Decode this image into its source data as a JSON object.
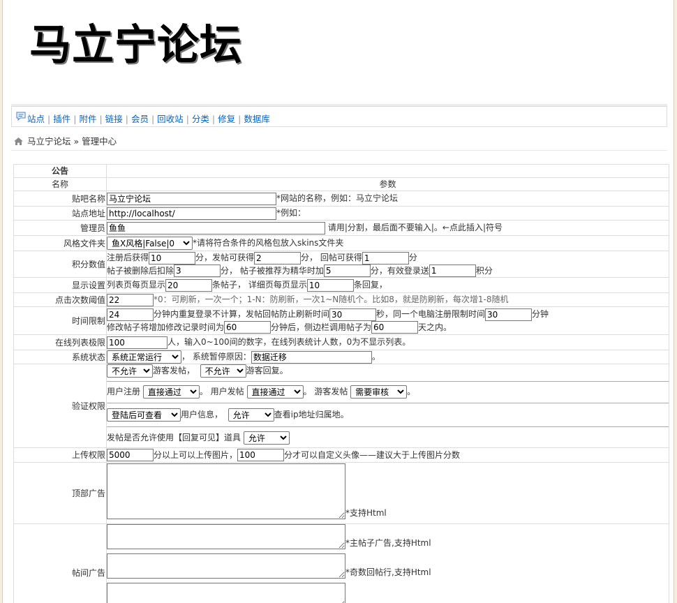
{
  "site": {
    "logo": "马立宁论坛"
  },
  "menu": [
    "站点",
    "插件",
    "附件",
    "链接",
    "会员",
    "回收站",
    "分类",
    "修复",
    "数据库"
  ],
  "breadcrumb": {
    "home": "马立宁论坛",
    "sep": " » ",
    "current": "管理中心"
  },
  "table": {
    "section": "公告",
    "col_name": "名称",
    "col_param": "参数",
    "forum_name": {
      "label": "贴吧名称",
      "value": "马立宁论坛",
      "hint": "*网站的名称，例如：马立宁论坛"
    },
    "site_url": {
      "label": "站点地址",
      "value": "http://localhost/",
      "hint": "*例如："
    },
    "admins": {
      "label": "管理员",
      "value": "鱼鱼",
      "hint": "请用|分割，最后面不要输入|。←点此插入|符号"
    },
    "skin": {
      "label": "风格文件夹",
      "selected": "鱼X风格|False|0",
      "hint": "*请将符合条件的风格包放入skins文件夹"
    },
    "points": {
      "label": "积分数值",
      "t1": "注册后获得",
      "reg": "10",
      "t2": "分，发帖可获得",
      "post": "2",
      "t3": "分，  回帖可获得",
      "reply": "1",
      "t4": "分",
      "t5": "帖子被删除后扣除",
      "del": "3",
      "t6": "分， 帖子被推荐为精华时加",
      "elite": "5",
      "t7": "分，有效登录送",
      "login": "1",
      "t8": "积分"
    },
    "display": {
      "label": "显示设置",
      "t1": "列表页每页显示",
      "list": "20",
      "t2": "条帖子， 详细页每页显示",
      "detail": "10",
      "t3": "条回复，"
    },
    "click": {
      "label": "点击次数阈值",
      "value": "22",
      "hint": "*0：可刷新，一次一个；1-N：防刷新，一次1~N随机个。比如8，就是防刷新，每次增1-8随机"
    },
    "time_limit": {
      "label": "时间限制",
      "v1": "24",
      "t1": "分钟内重复登录不计算，发帖回帖防止刷新时间",
      "v2": "30",
      "t2": "秒，同一个电脑注册限制时间",
      "v3": "30",
      "t3": "分钟",
      "t4": "修改帖子将增加修改记录时间为",
      "v4": "60",
      "t5": "分钟后，侧边栏调用帖子为",
      "v5": "60",
      "t6": "天之内。"
    },
    "online": {
      "label": "在线列表极限",
      "value": "100",
      "hint": "人，输入0~100间的数字，在线列表统计人数，0为不显示列表。"
    },
    "status": {
      "label": "系统状态",
      "selected": "系统正常运行",
      "t1": "，  系统暂停原因：",
      "reason": "数据迁移",
      "t2": "。"
    },
    "verify": {
      "label": "验证权限",
      "guest_post": "不允许",
      "t1": "游客发帖，",
      "guest_reply": "不允许",
      "t2": "游客回复。",
      "t3": "用户注册",
      "user_reg": "直接通过",
      "t4": "。 用户发帖",
      "user_post": "直接通过",
      "t5": "。 游客发帖",
      "guest_post2": "需要审核",
      "t6": "。",
      "user_info": "登陆后可查看",
      "t7": "用户信息，",
      "ip": "允许",
      "t8": "查看ip地址归属地。",
      "t9": "发帖是否允许使用【回复可见】道具",
      "reply_visible": "允许"
    },
    "upload": {
      "label": "上传权限",
      "v1": "5000",
      "t1": "分以上可以上传图片，",
      "v2": "100",
      "t2": "分才可以自定义头像——建议大于上传图片分数"
    },
    "top_ad": {
      "label": "顶部广告",
      "hint": "*支持Html"
    },
    "post_ad": {
      "label": "帖间广告",
      "hint1": "*主帖子广告,支持Html",
      "hint2": "*奇数回帖行,支持Html"
    }
  }
}
